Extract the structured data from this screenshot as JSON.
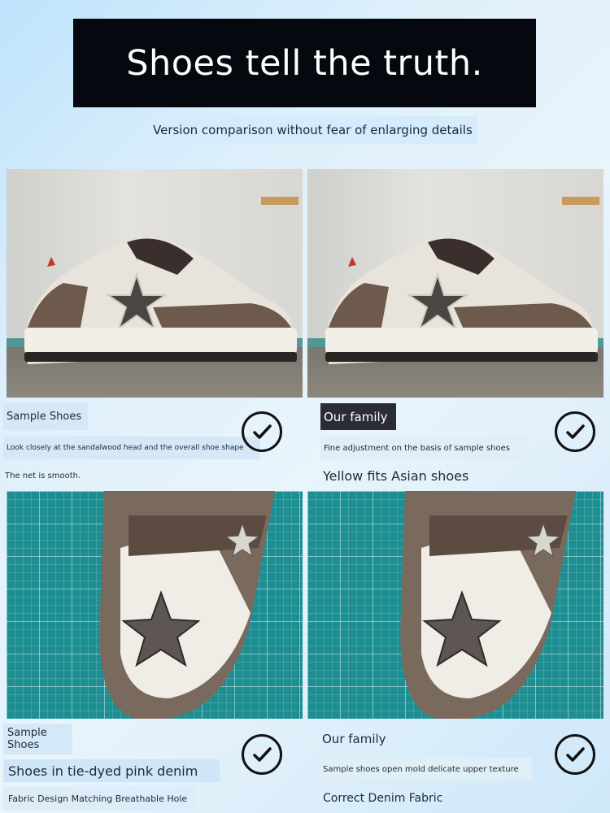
{
  "header": {
    "title": "Shoes tell the truth.",
    "subtitle": "Version comparison without fear of enlarging details"
  },
  "section1": {
    "left": {
      "tag": "Sample Shoes",
      "note": "Look closely at the sandalwood head and the overall shoe shape",
      "detail": "The net is smooth."
    },
    "right": {
      "tag": "Our family",
      "note": "Fine adjustment on the basis of sample shoes",
      "detail": "Yellow fits Asian shoes"
    }
  },
  "section2": {
    "left": {
      "tag_line1": "Sample",
      "tag_line2": "Shoes",
      "note": "Shoes in tie-dyed pink denim",
      "detail": "Fabric Design Matching Breathable Hole"
    },
    "right": {
      "tag": "Our family",
      "note": "Sample shoes open mold delicate upper texture",
      "detail": "Correct Denim Fabric"
    }
  },
  "icons": [
    "checkmark-circle-icon"
  ],
  "colors": {
    "title_bg": "#05080f",
    "accent_teal": "#1d8f92",
    "shoe_brown": "#6e5a4d"
  }
}
